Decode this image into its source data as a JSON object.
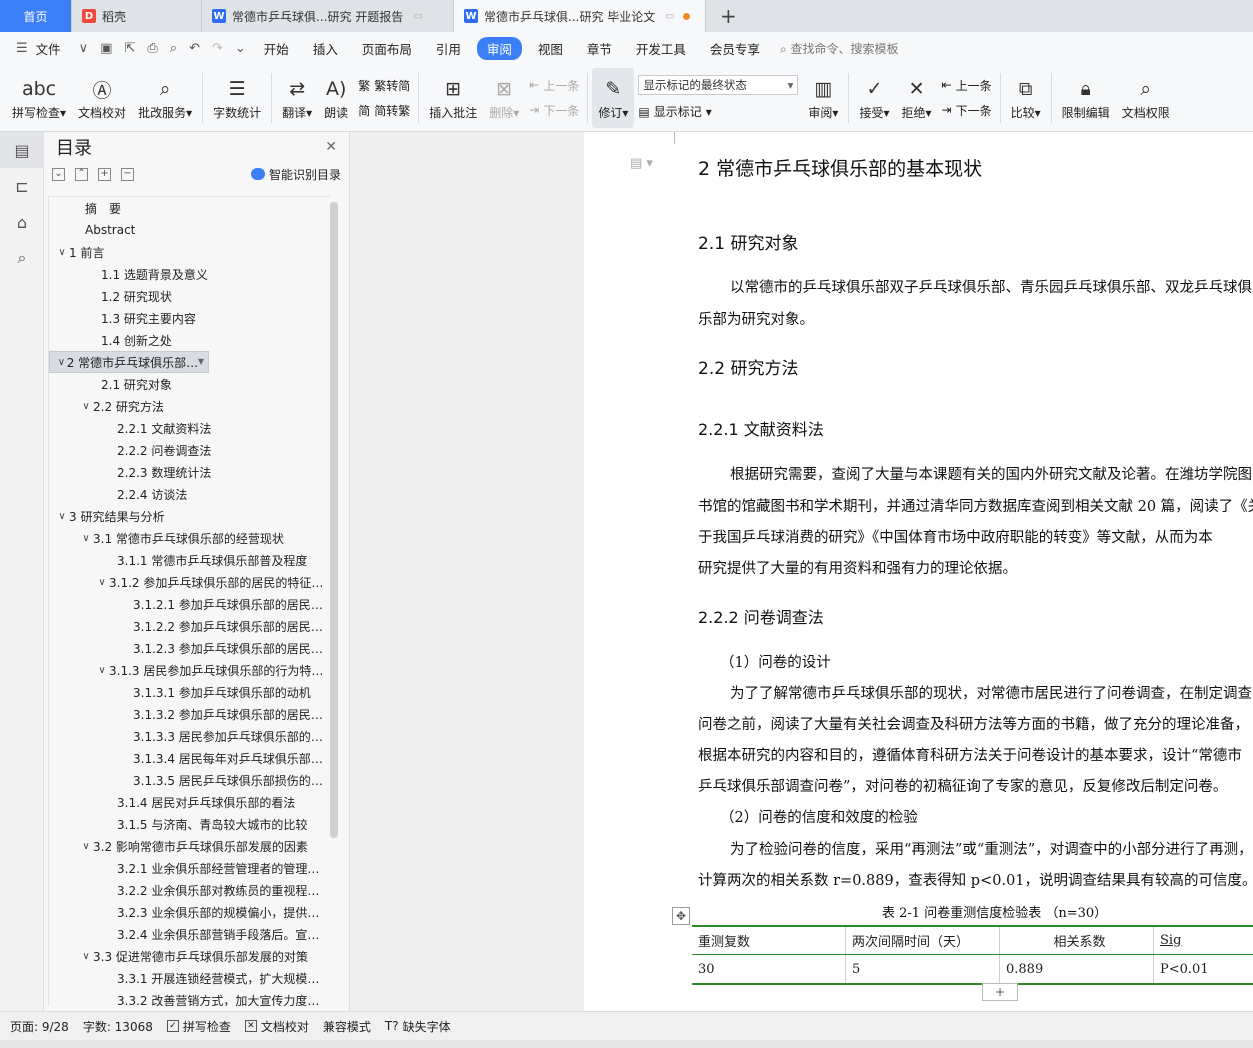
{
  "tabs": [
    {
      "label": "首页"
    },
    {
      "label": "稻壳"
    },
    {
      "label": "常德市乒乓球俱...研究 开题报告"
    },
    {
      "label": "常德市乒乓球俱...研究 毕业论文"
    }
  ],
  "menu": {
    "file": "文件",
    "items": [
      "开始",
      "插入",
      "页面布局",
      "引用",
      "审阅",
      "视图",
      "章节",
      "开发工具",
      "会员专享"
    ],
    "active": "审阅",
    "search_placeholder": "查找命令、搜索模板"
  },
  "ribbon": {
    "spellcheck": "拼写检查",
    "doc_proof": "文档校对",
    "annotate_service": "批改服务",
    "word_count": "字数统计",
    "translate": "翻译",
    "read_aloud": "朗读",
    "to_traditional": "繁转简",
    "to_simplified": "简转繁",
    "insert_comment": "插入批注",
    "delete": "删除",
    "prev_comment": "上一条",
    "next_comment": "下一条",
    "track_changes": "修订",
    "markup_mode": "显示标记的最终状态",
    "show_markup": "显示标记",
    "review": "审阅",
    "accept": "接受",
    "reject": "拒绝",
    "prev_change": "上一条",
    "next_change": "下一条",
    "compare": "比较",
    "restrict_edit": "限制编辑",
    "doc_rights": "文档权限"
  },
  "nav": {
    "title": "目录",
    "smart_toc": "智能识别目录",
    "toc": [
      {
        "label": "摘　要",
        "level": 1,
        "exp": ""
      },
      {
        "label": "Abstract",
        "level": 1,
        "exp": ""
      },
      {
        "label": "1 前言",
        "level": 0,
        "exp": "∨"
      },
      {
        "label": "1.1 选题背景及意义",
        "level": 2,
        "exp": ""
      },
      {
        "label": "1.2 研究现状",
        "level": 2,
        "exp": ""
      },
      {
        "label": "1.3 研究主要内容",
        "level": 2,
        "exp": ""
      },
      {
        "label": "1.4 创新之处",
        "level": 2,
        "exp": ""
      },
      {
        "label": "2  常德市乒乓球俱乐部的基本现状",
        "level": 0,
        "exp": "∨",
        "selected": true
      },
      {
        "label": "2.1  研究对象",
        "level": 2,
        "exp": ""
      },
      {
        "label": "2.2 研究方法",
        "level": 1.5,
        "exp": "∨"
      },
      {
        "label": "2.2.1 文献资料法",
        "level": 3,
        "exp": ""
      },
      {
        "label": "2.2.2 问卷调查法",
        "level": 3,
        "exp": ""
      },
      {
        "label": "2.2.3 数理统计法",
        "level": 3,
        "exp": ""
      },
      {
        "label": "2.2.4 访谈法",
        "level": 3,
        "exp": ""
      },
      {
        "label": "3  研究结果与分析",
        "level": 0,
        "exp": "∨"
      },
      {
        "label": "3.1  常德市乒乓球俱乐部的经营现状",
        "level": 1.5,
        "exp": "∨"
      },
      {
        "label": "3.1.1  常德市乒乓球俱乐部普及程度",
        "level": 3,
        "exp": ""
      },
      {
        "label": "3.1.2  参加乒乓球俱乐部的居民的特征…",
        "level": 2.5,
        "exp": "∨"
      },
      {
        "label": "3.1.2.1  参加乒乓球俱乐部的居民年…",
        "level": 4,
        "exp": ""
      },
      {
        "label": "3.1.2.2  参加乒乓球俱乐部的居民的…",
        "level": 4,
        "exp": ""
      },
      {
        "label": "3.1.2.3  参加乒乓球俱乐部的居民来…",
        "level": 4,
        "exp": ""
      },
      {
        "label": "3.1.3  居民参加乒乓球俱乐部的行为特…",
        "level": 2.5,
        "exp": "∨"
      },
      {
        "label": "3.1.3.1  参加乒乓球俱乐部的动机",
        "level": 4,
        "exp": ""
      },
      {
        "label": "3.1.3.2  参加乒乓球俱乐部的居民进…",
        "level": 4,
        "exp": ""
      },
      {
        "label": "3.1.3.3 居民参加乒乓球俱乐部的频…",
        "level": 4,
        "exp": ""
      },
      {
        "label": "3.1.3.4  居民每年对乒乓球俱乐部的…",
        "level": 4,
        "exp": ""
      },
      {
        "label": "3.1.3.5  居民乒乓球俱乐部损伤的统…",
        "level": 4,
        "exp": ""
      },
      {
        "label": "3.1.4  居民对乒乓球俱乐部的看法",
        "level": 3,
        "exp": ""
      },
      {
        "label": "3.1.5 与济南、青岛较大城市的比较",
        "level": 3,
        "exp": ""
      },
      {
        "label": "3.2  影响常德市乒乓球俱乐部发展的因素",
        "level": 1.5,
        "exp": "∨"
      },
      {
        "label": "3.2.1 业余俱乐部经营管理者的管理能…",
        "level": 3,
        "exp": ""
      },
      {
        "label": "3.2.2 业余俱乐部对教练员的重视程度…",
        "level": 3,
        "exp": ""
      },
      {
        "label": "3.2.3 业余俱乐部的规模偏小，提供的…",
        "level": 3,
        "exp": ""
      },
      {
        "label": "3.2.4 业余俱乐部营销手段落后。宣传…",
        "level": 3,
        "exp": ""
      },
      {
        "label": "3.3  促进常德市乒乓球俱乐部发展的对策",
        "level": 1.5,
        "exp": "∨"
      },
      {
        "label": "3.3.1 开展连锁经营模式，扩大规模效…",
        "level": 3,
        "exp": ""
      },
      {
        "label": "3.3.2 改善营销方式，加大宣传力度，…",
        "level": 3,
        "exp": ""
      }
    ]
  },
  "doc": {
    "h_2": "2  常德市乒乓球俱乐部的基本现状",
    "h_2_1": "2.1  研究对象",
    "p1_l1": "以常德市的乒乓球俱乐部双子乒乓球俱乐部、青乐园乒乓球俱乐部、双龙乒乓球俱",
    "p1_l2": "乐部为研究对象。",
    "h_2_2": "2.2 研究方法",
    "h_2_2_1": "2.2.1 文献资料法",
    "p2_l1": "根据研究需要，查阅了大量与本课题有关的国内外研究文献及论著。在潍坊学院图",
    "p2_l2": "书馆的馆藏图书和学术期刊，并通过清华同方数据库查阅到相关文献 20 篇，阅读了《关",
    "p2_l3": "于我国乒乓球消费的研究》《中国体育市场中政府职能的转变》等文献，从而为本",
    "p2_l4": "研究提供了大量的有用资料和强有力的理论依据。",
    "h_2_2_2": "2.2.2 问卷调查法",
    "p3_title": "（1）问卷的设计",
    "p3_l1": "为了了解常德市乒乓球俱乐部的现状，对常德市居民进行了问卷调查，在制定调查",
    "p3_l2": "问卷之前，阅读了大量有关社会调查及科研方法等方面的书籍，做了充分的理论准备，",
    "p3_l3": "根据本研究的内容和目的，遵循体育科研方法关于问卷设计的基本要求，设计“常德市",
    "p3_l4": "乒乓球俱乐部调查问卷”，对问卷的初稿征询了专家的意见，反复修改后制定问卷。",
    "p4_title": "（2）问卷的信度和效度的检验",
    "p4_l1": "为了检验问卷的信度，采用“再测法”或“重测法”，对调查中的小部分进行了再测，",
    "p4_l2": "计算两次的相关系数 r=0.889，查表得知 p<0.01，说明调查结果具有较高的可信度。",
    "table_caption": "表 2-1  问卷重测信度检验表  （n=30）",
    "table_head": [
      "重测复数",
      "两次间隔时间（天）",
      "相关系数",
      "Sig"
    ],
    "table_row": [
      "30",
      "5",
      "0.889",
      "P<0.01"
    ]
  },
  "status": {
    "page": "页面: 9/28",
    "words": "字数: 13068",
    "spell": "拼写检查",
    "proof": "文档校对",
    "compat": "兼容模式",
    "missing_font": "缺失字体"
  }
}
